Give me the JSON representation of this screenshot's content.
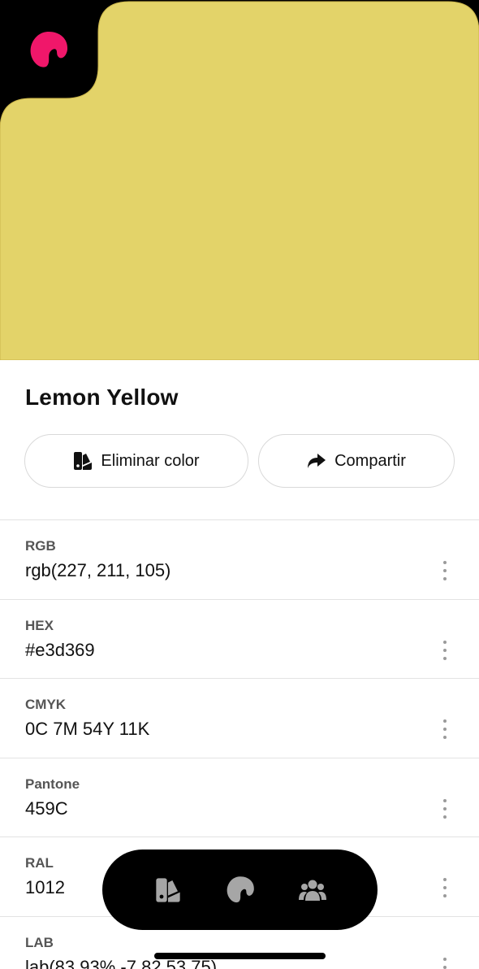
{
  "color": {
    "name": "Lemon Yellow",
    "swatch_hex": "#e3d369"
  },
  "brand": {
    "logo_color": "#f0176a"
  },
  "actions": {
    "delete_label": "Eliminar color",
    "share_label": "Compartir"
  },
  "formats": [
    {
      "label": "RGB",
      "value": "rgb(227, 211, 105)"
    },
    {
      "label": "HEX",
      "value": "#e3d369"
    },
    {
      "label": "CMYK",
      "value": "0C 7M 54Y 11K"
    },
    {
      "label": "Pantone",
      "value": "459C"
    },
    {
      "label": "RAL",
      "value": "1012"
    },
    {
      "label": "LAB",
      "value": "lab(83.93% -7.82 53.75)"
    }
  ],
  "tabbar": {
    "tabs": [
      {
        "icon": "swatches-icon"
      },
      {
        "icon": "palette-icon"
      },
      {
        "icon": "community-icon"
      }
    ]
  }
}
